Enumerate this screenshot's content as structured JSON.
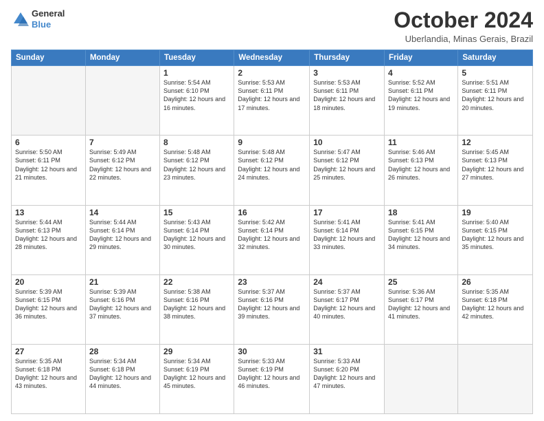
{
  "header": {
    "logo_line1": "General",
    "logo_line2": "Blue",
    "month": "October 2024",
    "location": "Uberlandia, Minas Gerais, Brazil"
  },
  "weekdays": [
    "Sunday",
    "Monday",
    "Tuesday",
    "Wednesday",
    "Thursday",
    "Friday",
    "Saturday"
  ],
  "weeks": [
    [
      {
        "day": "",
        "info": "",
        "empty": true
      },
      {
        "day": "",
        "info": "",
        "empty": true
      },
      {
        "day": "1",
        "info": "Sunrise: 5:54 AM\nSunset: 6:10 PM\nDaylight: 12 hours and 16 minutes."
      },
      {
        "day": "2",
        "info": "Sunrise: 5:53 AM\nSunset: 6:11 PM\nDaylight: 12 hours and 17 minutes."
      },
      {
        "day": "3",
        "info": "Sunrise: 5:53 AM\nSunset: 6:11 PM\nDaylight: 12 hours and 18 minutes."
      },
      {
        "day": "4",
        "info": "Sunrise: 5:52 AM\nSunset: 6:11 PM\nDaylight: 12 hours and 19 minutes."
      },
      {
        "day": "5",
        "info": "Sunrise: 5:51 AM\nSunset: 6:11 PM\nDaylight: 12 hours and 20 minutes."
      }
    ],
    [
      {
        "day": "6",
        "info": "Sunrise: 5:50 AM\nSunset: 6:11 PM\nDaylight: 12 hours and 21 minutes."
      },
      {
        "day": "7",
        "info": "Sunrise: 5:49 AM\nSunset: 6:12 PM\nDaylight: 12 hours and 22 minutes."
      },
      {
        "day": "8",
        "info": "Sunrise: 5:48 AM\nSunset: 6:12 PM\nDaylight: 12 hours and 23 minutes."
      },
      {
        "day": "9",
        "info": "Sunrise: 5:48 AM\nSunset: 6:12 PM\nDaylight: 12 hours and 24 minutes."
      },
      {
        "day": "10",
        "info": "Sunrise: 5:47 AM\nSunset: 6:12 PM\nDaylight: 12 hours and 25 minutes."
      },
      {
        "day": "11",
        "info": "Sunrise: 5:46 AM\nSunset: 6:13 PM\nDaylight: 12 hours and 26 minutes."
      },
      {
        "day": "12",
        "info": "Sunrise: 5:45 AM\nSunset: 6:13 PM\nDaylight: 12 hours and 27 minutes."
      }
    ],
    [
      {
        "day": "13",
        "info": "Sunrise: 5:44 AM\nSunset: 6:13 PM\nDaylight: 12 hours and 28 minutes."
      },
      {
        "day": "14",
        "info": "Sunrise: 5:44 AM\nSunset: 6:14 PM\nDaylight: 12 hours and 29 minutes."
      },
      {
        "day": "15",
        "info": "Sunrise: 5:43 AM\nSunset: 6:14 PM\nDaylight: 12 hours and 30 minutes."
      },
      {
        "day": "16",
        "info": "Sunrise: 5:42 AM\nSunset: 6:14 PM\nDaylight: 12 hours and 32 minutes."
      },
      {
        "day": "17",
        "info": "Sunrise: 5:41 AM\nSunset: 6:14 PM\nDaylight: 12 hours and 33 minutes."
      },
      {
        "day": "18",
        "info": "Sunrise: 5:41 AM\nSunset: 6:15 PM\nDaylight: 12 hours and 34 minutes."
      },
      {
        "day": "19",
        "info": "Sunrise: 5:40 AM\nSunset: 6:15 PM\nDaylight: 12 hours and 35 minutes."
      }
    ],
    [
      {
        "day": "20",
        "info": "Sunrise: 5:39 AM\nSunset: 6:15 PM\nDaylight: 12 hours and 36 minutes."
      },
      {
        "day": "21",
        "info": "Sunrise: 5:39 AM\nSunset: 6:16 PM\nDaylight: 12 hours and 37 minutes."
      },
      {
        "day": "22",
        "info": "Sunrise: 5:38 AM\nSunset: 6:16 PM\nDaylight: 12 hours and 38 minutes."
      },
      {
        "day": "23",
        "info": "Sunrise: 5:37 AM\nSunset: 6:16 PM\nDaylight: 12 hours and 39 minutes."
      },
      {
        "day": "24",
        "info": "Sunrise: 5:37 AM\nSunset: 6:17 PM\nDaylight: 12 hours and 40 minutes."
      },
      {
        "day": "25",
        "info": "Sunrise: 5:36 AM\nSunset: 6:17 PM\nDaylight: 12 hours and 41 minutes."
      },
      {
        "day": "26",
        "info": "Sunrise: 5:35 AM\nSunset: 6:18 PM\nDaylight: 12 hours and 42 minutes."
      }
    ],
    [
      {
        "day": "27",
        "info": "Sunrise: 5:35 AM\nSunset: 6:18 PM\nDaylight: 12 hours and 43 minutes."
      },
      {
        "day": "28",
        "info": "Sunrise: 5:34 AM\nSunset: 6:18 PM\nDaylight: 12 hours and 44 minutes."
      },
      {
        "day": "29",
        "info": "Sunrise: 5:34 AM\nSunset: 6:19 PM\nDaylight: 12 hours and 45 minutes."
      },
      {
        "day": "30",
        "info": "Sunrise: 5:33 AM\nSunset: 6:19 PM\nDaylight: 12 hours and 46 minutes."
      },
      {
        "day": "31",
        "info": "Sunrise: 5:33 AM\nSunset: 6:20 PM\nDaylight: 12 hours and 47 minutes."
      },
      {
        "day": "",
        "info": "",
        "empty": true
      },
      {
        "day": "",
        "info": "",
        "empty": true
      }
    ]
  ]
}
